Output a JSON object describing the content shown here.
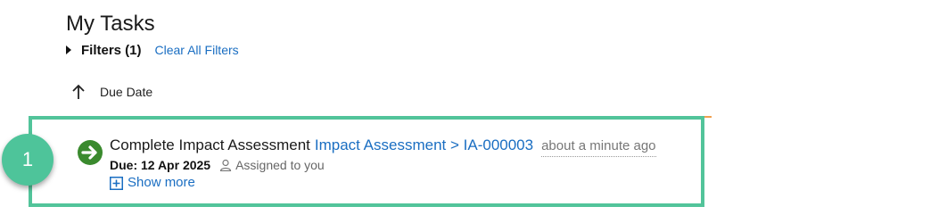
{
  "header": {
    "title": "My Tasks"
  },
  "filters": {
    "label": "Filters (1)",
    "clear_label": "Clear All Filters"
  },
  "sort": {
    "label": "Due Date",
    "direction_icon": "arrow-up-icon"
  },
  "callout": {
    "number": "1",
    "color": "#52c49a"
  },
  "task": {
    "icon": "arrow-right-circle-icon",
    "icon_color": "#3a8a2e",
    "title": "Complete Impact Assessment",
    "link": "Impact Assessment > IA-000003",
    "time": "about a minute ago",
    "due": "Due: 12 Apr 2025",
    "assigned": "Assigned to you",
    "show_more": "Show more"
  },
  "colors": {
    "link": "#1a6ec2",
    "highlight": "#52c49a",
    "accent_line": "#f0a050"
  }
}
